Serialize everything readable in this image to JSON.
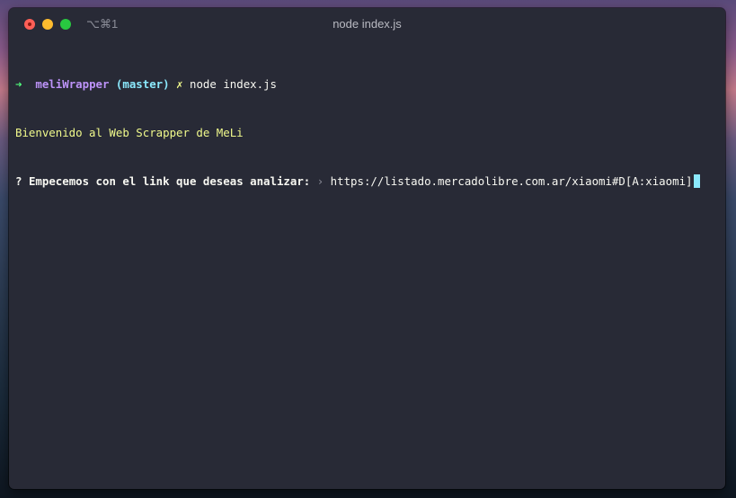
{
  "window": {
    "shortcut": "⌥⌘1",
    "title": "node index.js"
  },
  "terminal": {
    "prompt": {
      "arrow": "➜",
      "directory": "meliWrapper",
      "git_branch": "(master)",
      "git_status": "✗",
      "command": "node index.js"
    },
    "welcome": "Bienvenido al Web Scrapper de MeLi",
    "question": {
      "marker": "?",
      "text": "Empecemos con el link que deseas analizar:",
      "pointer": "›",
      "answer": "https://listado.mercadolibre.com.ar/xiaomi#D[A:xiaomi]"
    }
  },
  "colors": {
    "background": "#282a36",
    "prompt_arrow": "#50fa7b",
    "directory": "#bd93f9",
    "branch": "#8be9fd",
    "welcome": "#f1fa8c",
    "cursor": "#8be9fd"
  }
}
